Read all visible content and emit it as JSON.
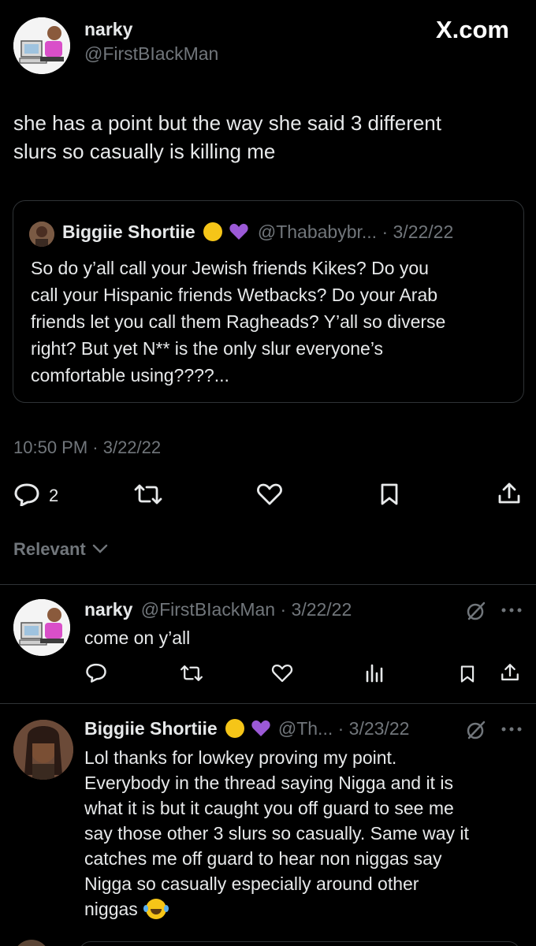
{
  "watermark": "X.com",
  "main_tweet": {
    "display_name": "narky",
    "handle": "@FirstBIackMan",
    "text_line1": "she has a point but the way she said 3 different",
    "text_line2": "slurs so casually is killing me",
    "timestamp": "10:50 PM · 3/22/22",
    "reply_count": "2"
  },
  "quoted_tweet": {
    "display_name": "Biggiie Shortiie",
    "handle_date": "@Thababybr... · 3/22/22",
    "lines": [
      "So do y’all call your Jewish friends Kikes? Do you",
      "call your Hispanic friends Wetbacks? Do your Arab",
      "friends let you call them Ragheads? Y’all so diverse",
      "right? But yet N** is the only slur everyone’s",
      "comfortable using????..."
    ]
  },
  "sort": {
    "label": "Relevant"
  },
  "reply1": {
    "display_name": "narky",
    "handle_date": "@FirstBIackMan · 3/22/22",
    "text": "come on y’all"
  },
  "reply2": {
    "display_name": "Biggiie Shortiie",
    "handle_date": "@Th... · 3/23/22",
    "lines": [
      "Lol thanks for lowkey proving my point.",
      "Everybody in the thread saying Nigga and it is",
      "what it is but it caught you off guard to see me",
      "say those other 3 slurs so casually. Same way it",
      "catches me off guard to hear non niggas say",
      "Nigga so casually especially around other",
      "niggas"
    ]
  },
  "colors": {
    "background": "#000000",
    "text": "#e7e9ea",
    "muted": "#71767b",
    "divider": "#2f3336",
    "heart_purple": "#9b59d6"
  }
}
